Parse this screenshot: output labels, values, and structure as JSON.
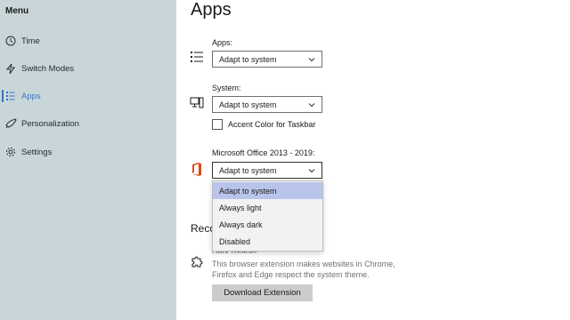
{
  "sidebar": {
    "title": "Menu",
    "accent": "#3b73c4",
    "items": [
      {
        "label": "Time",
        "icon": "clock-icon",
        "active": false
      },
      {
        "label": "Switch Modes",
        "icon": "lightning-icon",
        "active": false
      },
      {
        "label": "Apps",
        "icon": "apps-list-icon",
        "active": true
      },
      {
        "label": "Personalization",
        "icon": "paint-icon",
        "active": false
      },
      {
        "label": "Settings",
        "icon": "gear-icon",
        "active": false
      }
    ]
  },
  "main": {
    "title": "Apps",
    "apps": {
      "label": "Apps:",
      "value": "Adapt to system",
      "icon": "list-icon"
    },
    "system": {
      "label": "System:",
      "value": "Adapt to system",
      "icon": "computer-icon"
    },
    "accent_checkbox": {
      "label": "Accent Color for Taskbar",
      "checked": false
    },
    "office": {
      "label": "Microsoft Office 2013 - 2019:",
      "value": "Adapt to system",
      "icon": "office-logo-icon"
    },
    "dropdown_options": [
      "Adapt to system",
      "Always light",
      "Always dark",
      "Disabled"
    ],
    "dropdown_selected": "Adapt to system",
    "section_heading": "Reco",
    "extension": {
      "title": "Dark Reader",
      "description": "This browser extension makes websites in Chrome, Firefox and Edge respect the system theme.",
      "button_label": "Download Extension",
      "icon": "puzzle-icon"
    }
  }
}
